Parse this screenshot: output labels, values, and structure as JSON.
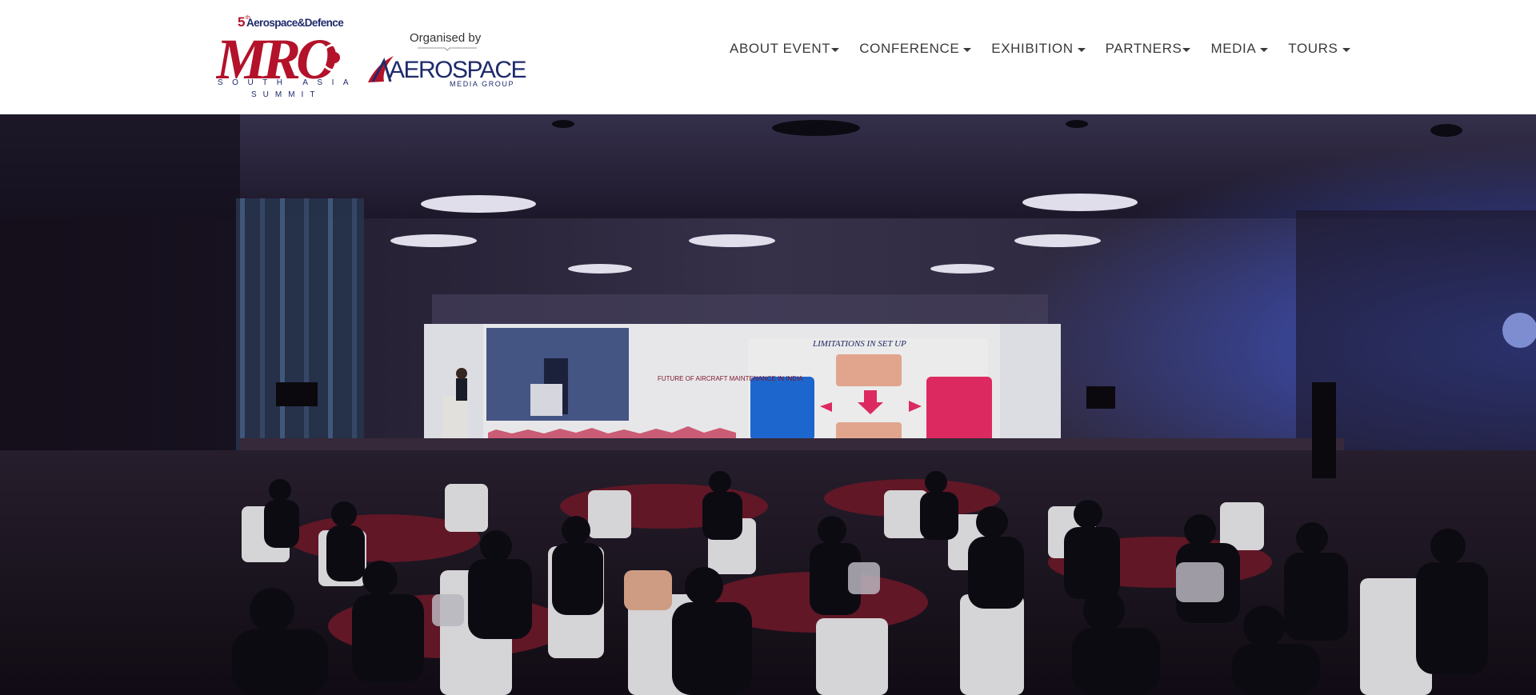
{
  "logo": {
    "edition": "5",
    "edition_suffix": "th",
    "line1": "Aerospace&Defence",
    "main": "MRO",
    "region": "SOUTH ASIA",
    "event": "SUMMIT"
  },
  "organiser": {
    "caption": "Organised by",
    "name": "AEROSPACE",
    "tagline": "MEDIA GROUP"
  },
  "nav": {
    "items": [
      {
        "label": "ABOUT EVENT"
      },
      {
        "label": "CONFERENCE"
      },
      {
        "label": "EXHIBITION"
      },
      {
        "label": "PARTNERS"
      },
      {
        "label": "MEDIA"
      },
      {
        "label": "TOURS"
      }
    ]
  },
  "hero": {
    "screen_title": "LIMITATIONS IN SET UP",
    "screen_subtitle": "FUTURE OF AIRCRAFT MAINTENANCE IN INDIA"
  },
  "colors": {
    "brand_red": "#b3122a",
    "brand_navy": "#1f2a6b",
    "nav_text": "#3a3a3a",
    "header_bg": "#ffffff"
  }
}
